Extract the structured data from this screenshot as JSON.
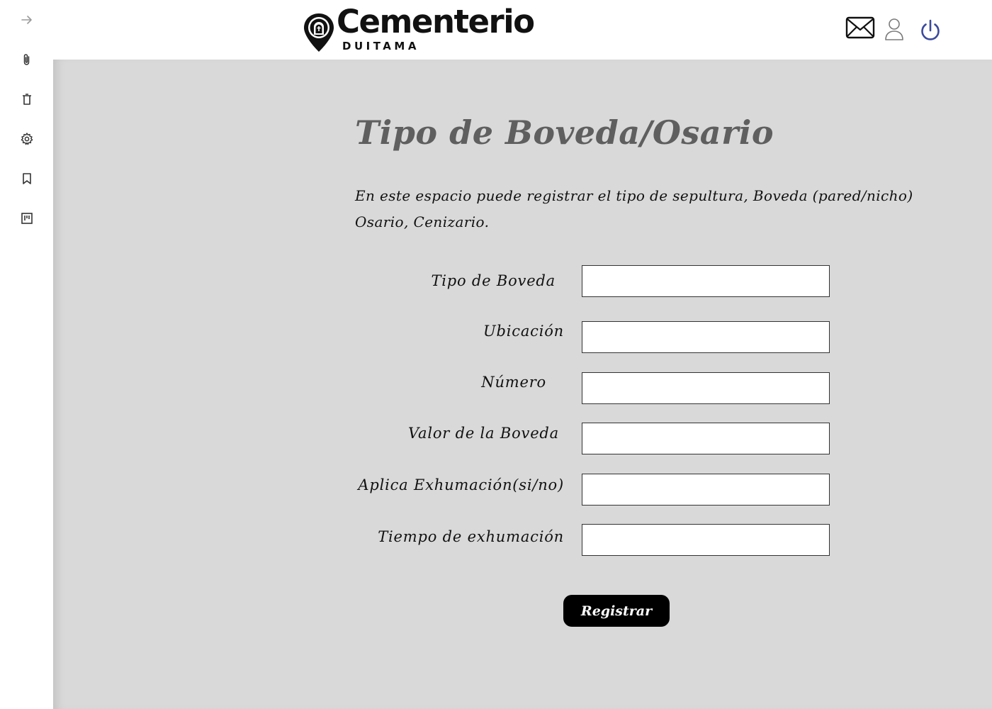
{
  "app": {
    "brand": "Cementerio",
    "brand_sub": "DUITAMA"
  },
  "sidebar": {
    "items": [
      {
        "icon": "arrow-right-icon"
      },
      {
        "icon": "paperclip-icon"
      },
      {
        "icon": "trash-icon"
      },
      {
        "icon": "gear-icon"
      },
      {
        "icon": "bookmark-icon"
      },
      {
        "icon": "board-icon"
      }
    ]
  },
  "header": {
    "icons": [
      "mail-icon",
      "user-icon",
      "power-icon"
    ],
    "power_color": "#3b4a9c"
  },
  "page": {
    "title": "Tipo de Boveda/Osario",
    "description": "En este espacio puede registrar el tipo de sepultura, Boveda (pared/nicho) Osario, Cenizario."
  },
  "form": {
    "fields": [
      {
        "label": "Tipo de Boveda",
        "value": ""
      },
      {
        "label": "Ubicación",
        "value": ""
      },
      {
        "label": "Número",
        "value": ""
      },
      {
        "label": "Valor de la Boveda",
        "value": ""
      },
      {
        "label": "Aplica Exhumación(si/no)",
        "value": ""
      },
      {
        "label": "Tiempo de exhumación",
        "value": ""
      }
    ],
    "submit_label": "Registrar"
  },
  "colors": {
    "main_bg": "#d9d9d9",
    "title": "#5f5f5f",
    "button_bg": "#000000"
  }
}
